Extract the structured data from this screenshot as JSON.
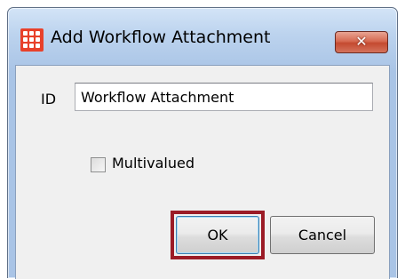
{
  "window": {
    "title": "Add Workflow Attachment",
    "app_icon": "app-grid-icon",
    "close_glyph": "x"
  },
  "form": {
    "id_label": "ID",
    "id_value": "Workflow Attachment",
    "multivalued_label": "Multivalued",
    "multivalued_checked": false
  },
  "buttons": {
    "ok_label": "OK",
    "cancel_label": "Cancel",
    "highlighted": "OK"
  },
  "colors": {
    "app_icon": "#e8412b",
    "highlight_border": "#9b1b26",
    "close_button": "#c44a30"
  }
}
